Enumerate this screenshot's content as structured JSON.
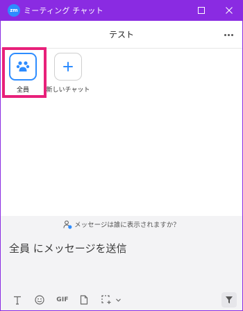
{
  "window": {
    "app_logo_text": "zm",
    "title": "ミーティング チャット",
    "maximize_icon": "maximize-icon",
    "close_icon": "close-icon",
    "frame_color": "#8a2be2"
  },
  "header": {
    "title": "テスト",
    "more_icon": "more-horizontal-icon"
  },
  "targets": [
    {
      "label": "全員",
      "icon": "people-icon",
      "selected": true
    },
    {
      "label": "新しいチャット",
      "icon": "plus-icon",
      "selected": false
    }
  ],
  "visibility": {
    "icon": "person-info-icon",
    "text": "メッセージは誰に表示されますか？"
  },
  "composer": {
    "placeholder": "全員 にメッセージを送信",
    "value": "",
    "tools": [
      {
        "name": "text-format",
        "icon": "text-format-icon"
      },
      {
        "name": "emoji",
        "icon": "emoji-icon"
      },
      {
        "name": "gif",
        "label": "GIF"
      },
      {
        "name": "file",
        "icon": "file-icon"
      },
      {
        "name": "screenshot",
        "icon": "screenshot-icon"
      },
      {
        "name": "more",
        "icon": "chevron-down-icon"
      }
    ],
    "send_icon": "send-icon"
  },
  "colors": {
    "accent": "#2d8cff",
    "highlight": "#e8207a",
    "composer_bg": "#f3f3f5"
  }
}
